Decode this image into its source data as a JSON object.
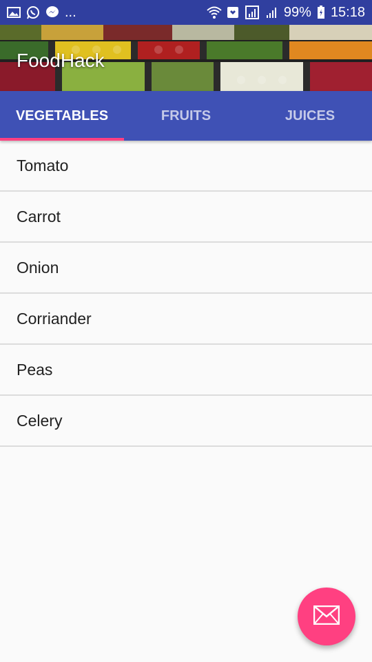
{
  "status_bar": {
    "overflow_dots": "...",
    "battery": "99%",
    "time": "15:18",
    "left_icons": [
      "gallery-icon",
      "whatsapp-icon",
      "messenger-icon"
    ],
    "right_icons": [
      "wifi-icon",
      "nfc-icon",
      "signal-icon",
      "battery-icon"
    ]
  },
  "app_bar": {
    "title": "FoodHack"
  },
  "tabs": [
    {
      "label": "VEGETABLES",
      "active": true
    },
    {
      "label": "FRUITS",
      "active": false
    },
    {
      "label": "JUICES",
      "active": false
    }
  ],
  "items": [
    {
      "label": "Tomato"
    },
    {
      "label": "Carrot"
    },
    {
      "label": "Onion"
    },
    {
      "label": "Corriander"
    },
    {
      "label": "Peas"
    },
    {
      "label": "Celery"
    }
  ],
  "fab": {
    "icon": "mail-icon"
  },
  "colors": {
    "primary": "#3f51b5",
    "primary_dark": "#303f9f",
    "accent": "#ff4081"
  }
}
